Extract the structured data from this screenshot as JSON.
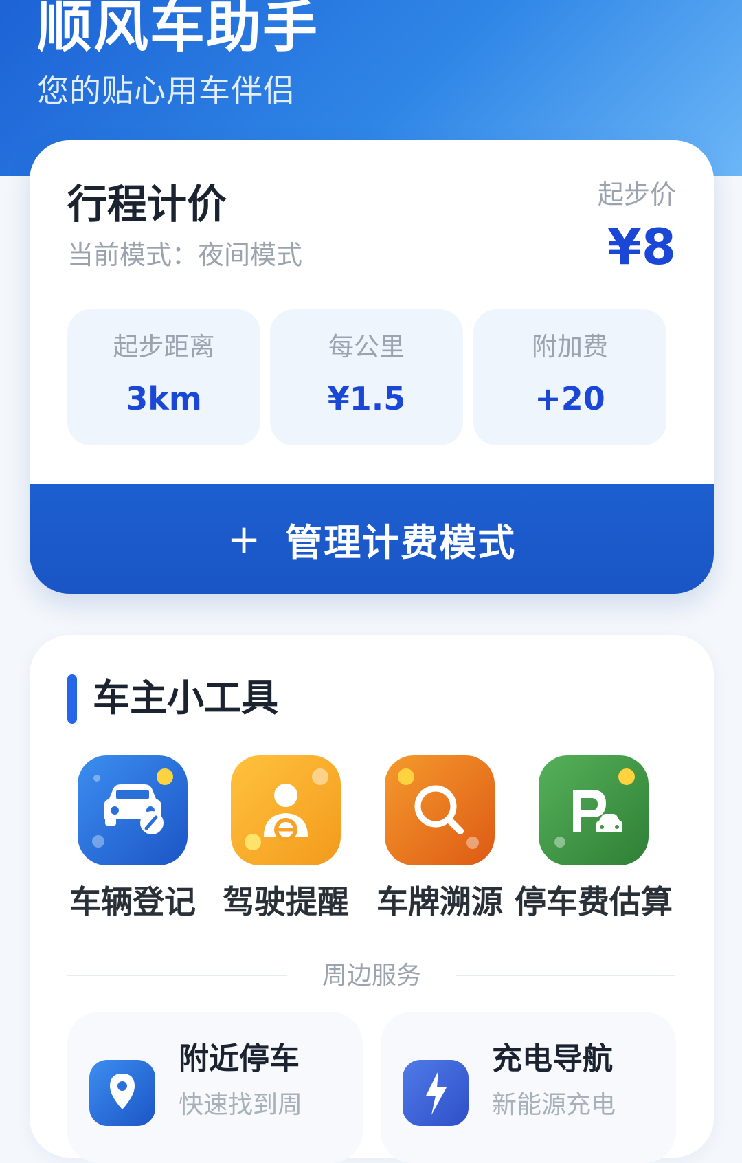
{
  "header": {
    "title": "顺风车助手",
    "subtitle": "您的贴心用车伴侣"
  },
  "pricing": {
    "title": "行程计价",
    "mode_text": "当前模式：夜间模式",
    "start_price_label": "起步价",
    "start_price_value": "¥8",
    "stats": [
      {
        "label": "起步距离",
        "value": "3km"
      },
      {
        "label": "每公里",
        "value": "¥1.5"
      },
      {
        "label": "附加费",
        "value": "+20"
      }
    ],
    "manage_button": {
      "icon": "+",
      "label": "管理计费模式"
    }
  },
  "tools": {
    "title": "车主小工具",
    "items": [
      {
        "label": "车辆登记",
        "icon": "car-edit-icon",
        "color": "#2b73de"
      },
      {
        "label": "驾驶提醒",
        "icon": "driver-icon",
        "color": "#f7a628"
      },
      {
        "label": "车牌溯源",
        "icon": "search-icon",
        "color": "#ea7a1e"
      },
      {
        "label": "停车费估算",
        "icon": "parking-icon",
        "color": "#3e9a44"
      }
    ],
    "section_divider": "周边服务",
    "services": [
      {
        "title": "附近停车",
        "desc": "快速找到周",
        "icon": "location-pin-icon",
        "color": "#2b73de"
      },
      {
        "title": "充电导航",
        "desc": "新能源充电",
        "icon": "charging-bolt-icon",
        "color": "#3f62d8"
      }
    ]
  },
  "colors": {
    "accent": "#1a47d6",
    "header_gradient_start": "#1d63d6",
    "header_gradient_end": "#6cb6f7",
    "button_blue": "#1d5fd0"
  }
}
